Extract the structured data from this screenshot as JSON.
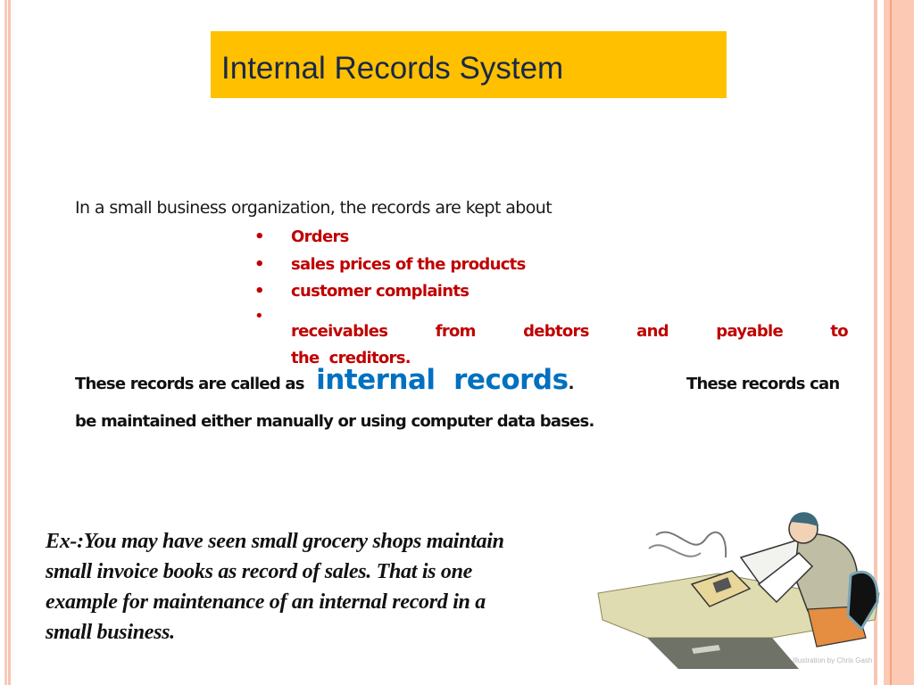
{
  "slide": {
    "title": "Internal Records System",
    "intro": "In a small business organization, the records are kept about",
    "bullets": [
      "Orders",
      "sales prices of the products",
      "customer complaints"
    ],
    "bullet4": {
      "words": [
        "receivables",
        "from",
        "debtors",
        "and",
        "payable",
        "to"
      ],
      "continuation": "the  creditors."
    },
    "bullet_symbol": "•",
    "called_prefix": "These records are called as",
    "called_highlight": "internal  records",
    "called_period": ".",
    "called_suffix": "These records can",
    "maintained": "be maintained either manually or using computer data bases.",
    "example_lines": [
      "Ex-:You may have seen small grocery shops maintain",
      "small invoice books as record of sales. That is one",
      "example for maintenance of an internal record in a",
      "small business."
    ],
    "illustration": {
      "icon": "accountant-at-desk-illustration",
      "credit": "Illustration by Chris Gash"
    },
    "colors": {
      "title_bg": "#ffc000",
      "title_text": "#17284a",
      "bullet_text": "#c00000",
      "highlight": "#0070c0",
      "border": "#fbc9b4"
    }
  }
}
